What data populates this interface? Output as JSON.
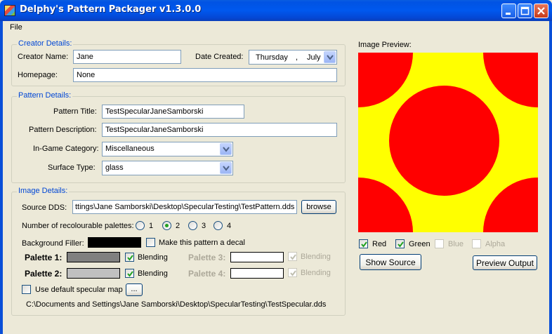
{
  "window": {
    "title": "Delphy's Pattern Packager v1.3.0.0"
  },
  "menu": {
    "file": "File"
  },
  "creator": {
    "legend": "Creator Details:",
    "name_label": "Creator Name:",
    "name_value": "Jane",
    "date_label": "Date Created:",
    "date_day": "Thursday",
    "date_sep": ",",
    "date_month": "July",
    "homepage_label": "Homepage:",
    "homepage_value": "None"
  },
  "pattern": {
    "legend": "Pattern Details:",
    "title_label": "Pattern Title:",
    "title_value": "TestSpecularJaneSamborski",
    "desc_label": "Pattern Description:",
    "desc_value": "TestSpecularJaneSamborski",
    "category_label": "In-Game Category:",
    "category_value": "Miscellaneous",
    "surface_label": "Surface Type:",
    "surface_value": "glass"
  },
  "image": {
    "legend": "Image Details:",
    "source_label": "Source DDS:",
    "source_value": "ttings\\Jane Samborski\\Desktop\\SpecularTesting\\TestPattern.dds",
    "browse": "browse",
    "palettes_label": "Number of recolourable palettes:",
    "palette_options": [
      "1",
      "2",
      "3",
      "4"
    ],
    "palette_selected": "2",
    "bg_filler_label": "Background Filler:",
    "bg_filler_color": "#000000",
    "decal_label": "Make this pattern a decal",
    "palette1_label": "Palette 1:",
    "palette1_color": "#808080",
    "palette2_label": "Palette 2:",
    "palette2_color": "#c0c0c0",
    "palette3_label": "Palette 3:",
    "palette4_label": "Palette 4:",
    "blending_label": "Blending",
    "specular_label": "Use default specular map",
    "specular_btn": "...",
    "specular_path": "C:\\Documents and Settings\\Jane Samborski\\Desktop\\SpecularTesting\\TestSpecular.dds"
  },
  "preview": {
    "label": "Image Preview:",
    "bg_color": "#ffff00",
    "circle_color": "#ff0000",
    "red": "Red",
    "green": "Green",
    "blue": "Blue",
    "alpha": "Alpha",
    "show_source": "Show Source",
    "preview_output": "Preview Output"
  }
}
